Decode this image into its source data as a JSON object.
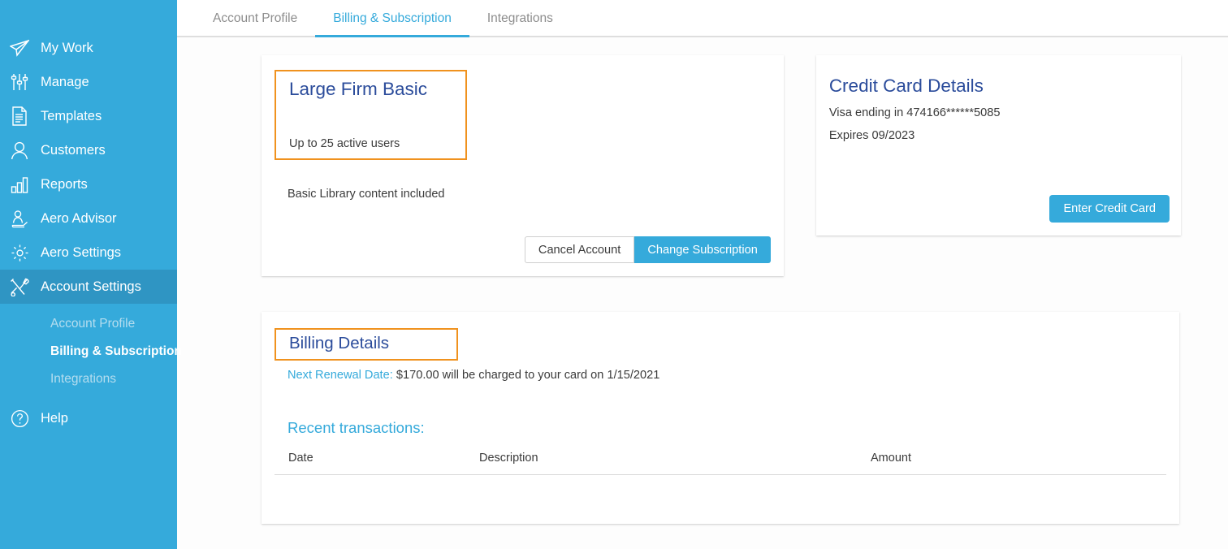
{
  "sidebar": {
    "items": [
      {
        "label": "My Work",
        "icon": "paper-plane-icon",
        "key": "my-work",
        "active": false
      },
      {
        "label": "Manage",
        "icon": "sliders-icon",
        "key": "manage",
        "active": false
      },
      {
        "label": "Templates",
        "icon": "document-icon",
        "key": "templates",
        "active": false
      },
      {
        "label": "Customers",
        "icon": "person-icon",
        "key": "customers",
        "active": false
      },
      {
        "label": "Reports",
        "icon": "bar-chart-icon",
        "key": "reports",
        "active": false
      },
      {
        "label": "Aero Advisor",
        "icon": "advisor-icon",
        "key": "aero-advisor",
        "active": false
      },
      {
        "label": "Aero Settings",
        "icon": "gear-icon",
        "key": "aero-settings",
        "active": false
      },
      {
        "label": "Account Settings",
        "icon": "tools-icon",
        "key": "account-settings",
        "active": true
      }
    ],
    "subitems": [
      {
        "label": "Account Profile",
        "key": "account-profile",
        "active": false
      },
      {
        "label": "Billing & Subscription",
        "key": "billing-subscription",
        "active": true
      },
      {
        "label": "Integrations",
        "key": "integrations",
        "active": false
      }
    ],
    "help": {
      "label": "Help",
      "icon": "question-circle-icon"
    }
  },
  "tabs": [
    {
      "label": "Account Profile",
      "active": false
    },
    {
      "label": "Billing & Subscription",
      "active": true
    },
    {
      "label": "Integrations",
      "active": false
    }
  ],
  "subscription": {
    "plan_name": "Large Firm Basic",
    "plan_users": "Up to 25 active users",
    "plan_extra": "Basic Library content included",
    "cancel_label": "Cancel Account",
    "change_label": "Change Subscription"
  },
  "credit_card": {
    "title": "Credit Card Details",
    "card_line": "Visa ending in 474166******5085",
    "expires_line": "Expires 09/2023",
    "enter_label": "Enter Credit Card"
  },
  "billing": {
    "title": "Billing Details",
    "renewal_label": "Next Renewal Date:",
    "renewal_text": "$170.00 will be charged to your card on 1/15/2021",
    "recent_label": "Recent transactions:",
    "columns": [
      "Date",
      "Description",
      "Amount"
    ],
    "rows": []
  },
  "colors": {
    "sidebar_blue": "#35aadb",
    "sidebar_active_blue": "#2f95c3",
    "accent_blue": "#35aadb",
    "heading_navy": "#2b4c9b",
    "highlight_orange": "#f0921e",
    "page_background": "#fdfdfd",
    "muted_gray": "#8d8d8d"
  }
}
